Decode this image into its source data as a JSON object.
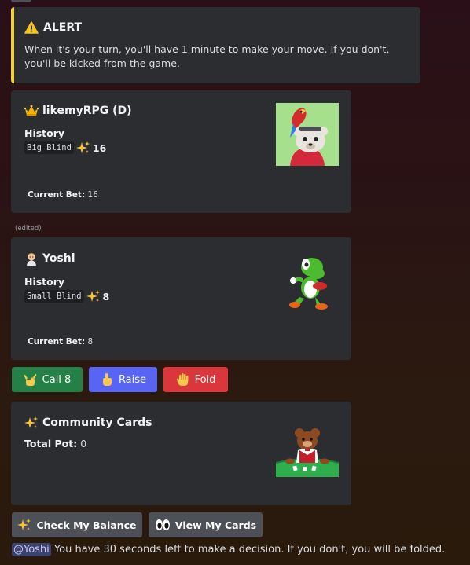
{
  "alert": {
    "icon": "warning-icon",
    "title": "ALERT",
    "text": "When it's your turn, you'll have 1 minute to make your move. If you don't, you'll be kicked from the game."
  },
  "player1": {
    "icon": "crown-icon",
    "name": "likemyRPG (D)",
    "history_label": "History",
    "history_action": "Big Blind",
    "history_icon": "sparkles-icon",
    "history_value": "16",
    "current_bet_label": "Current Bet:",
    "current_bet_value": "16",
    "thumbnail": "bear-with-parrot-avatar"
  },
  "edited_label": "(edited)",
  "player2": {
    "icon": "person-icon",
    "name": "Yoshi",
    "history_label": "History",
    "history_action": "Small Blind",
    "history_icon": "sparkles-icon",
    "history_value": "8",
    "current_bet_label": "Current Bet:",
    "current_bet_value": "8",
    "thumbnail": "yoshi-avatar"
  },
  "actions": {
    "call_label": "Call 8",
    "call_icon": "call-hand-icon",
    "raise_label": "Raise",
    "raise_icon": "pointing-up-icon",
    "fold_label": "Fold",
    "fold_icon": "raised-hand-icon"
  },
  "community": {
    "icon": "sparkles-icon",
    "title": "Community Cards",
    "pot_label": "Total Pot:",
    "pot_value": "0",
    "thumbnail": "bear-dealer-table"
  },
  "bottom_buttons": {
    "balance_label": "Check My Balance",
    "balance_icon": "sparkles-icon",
    "cards_label": "View My Cards",
    "cards_icon": "eyes-icon"
  },
  "footer": {
    "mention": "@Yoshi",
    "text": " You have 30 seconds left to make a decision. If you don't, you will be folded."
  },
  "colors": {
    "alert_accent": "#f0d23d",
    "call_green": "#248046",
    "raise_blurple": "#5865f2",
    "fold_red": "#da373c",
    "secondary_grey": "#4e5058"
  }
}
